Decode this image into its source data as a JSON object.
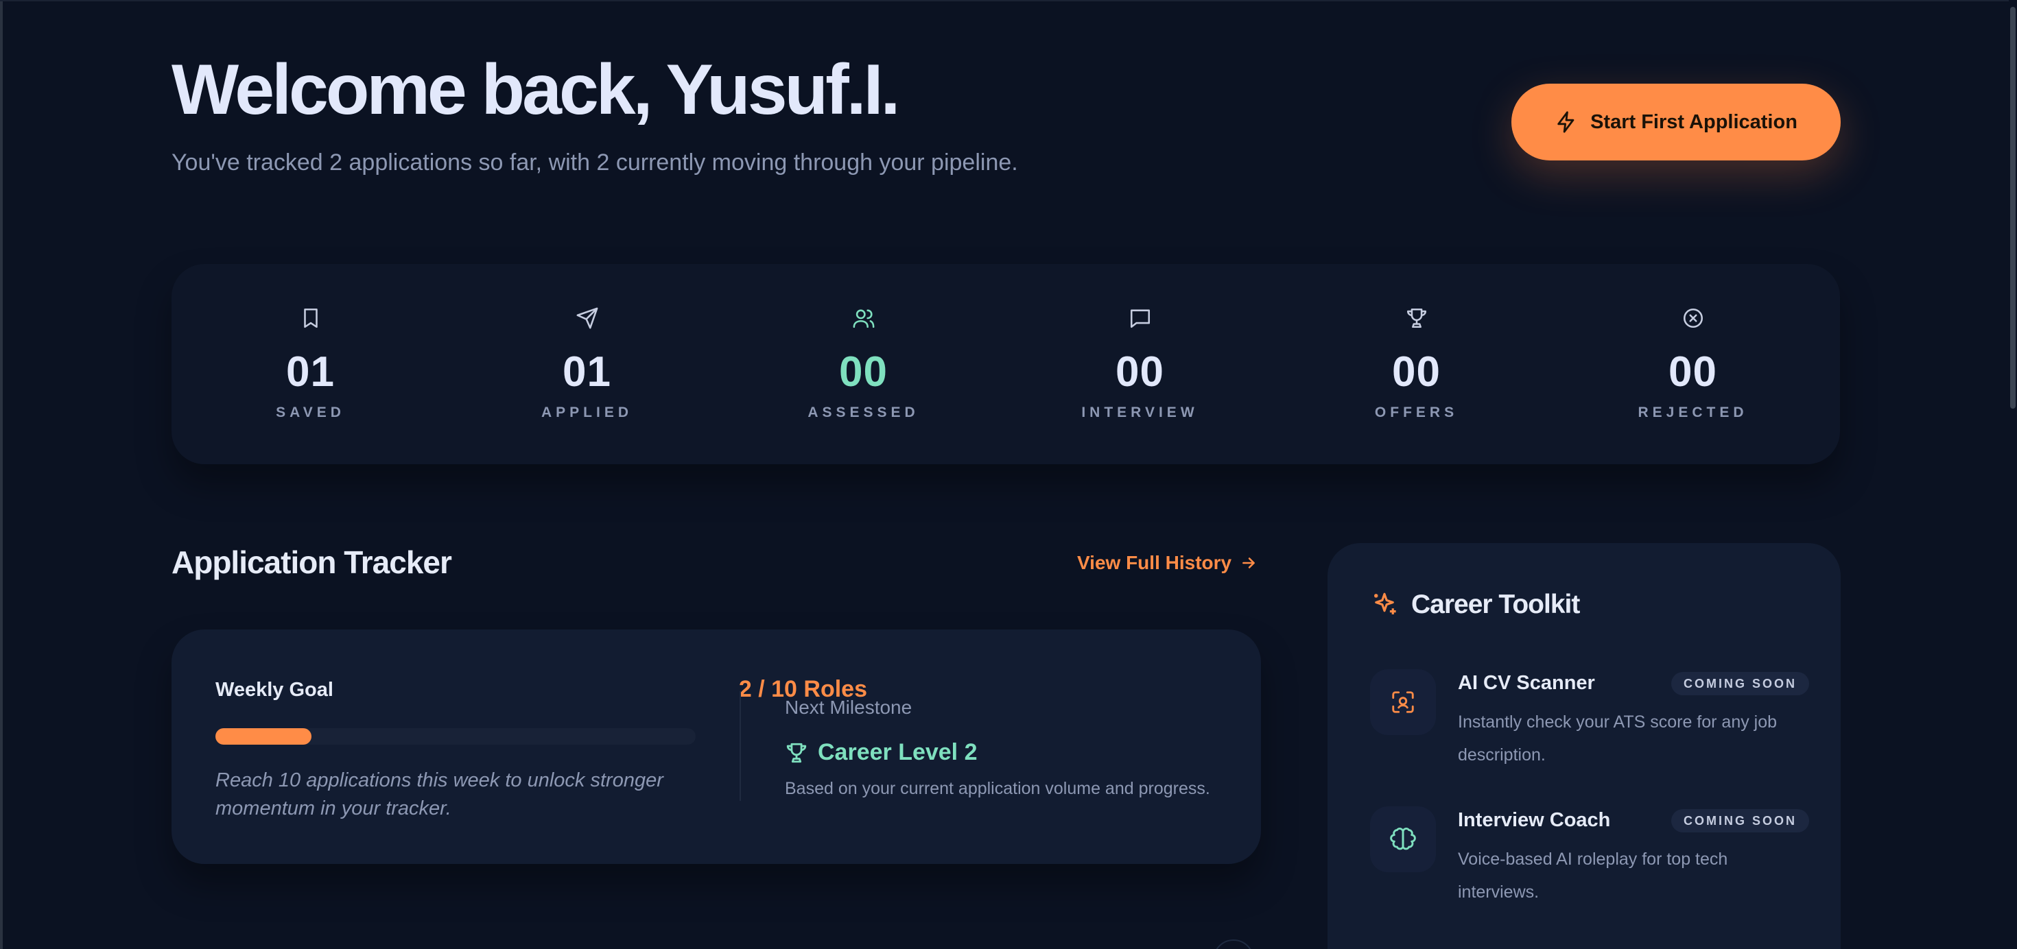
{
  "header": {
    "title": "Welcome back, Yusuf.I.",
    "subtitle": "You've tracked 2 applications so far, with 2 currently moving through your pipeline.",
    "cta_label": "Start First Application",
    "cta_icon": "lightning-icon"
  },
  "stats": [
    {
      "value": "01",
      "label": "SAVED",
      "icon": "bookmark-icon"
    },
    {
      "value": "01",
      "label": "APPLIED",
      "icon": "send-icon"
    },
    {
      "value": "00",
      "label": "ASSESSED",
      "icon": "users-icon"
    },
    {
      "value": "00",
      "label": "INTERVIEW",
      "icon": "message-icon"
    },
    {
      "value": "00",
      "label": "OFFERS",
      "icon": "trophy-icon"
    },
    {
      "value": "00",
      "label": "REJECTED",
      "icon": "x-circle-icon"
    }
  ],
  "tracker": {
    "title": "Application Tracker",
    "history_link": "View Full History",
    "weekly_goal_label": "Weekly Goal",
    "weekly_goal_count": "2 / 10 Roles",
    "weekly_goal_progress": 0.2,
    "weekly_goal_note": "Reach 10 applications this week to unlock stronger momentum in your tracker.",
    "milestone_label": "Next Milestone",
    "milestone_name": "Career Level 2",
    "milestone_desc": "Based on your current application volume and progress."
  },
  "toolkit": {
    "title": "Career Toolkit",
    "tools": [
      {
        "name": "AI CV Scanner",
        "badge": "COMING SOON",
        "desc": "Instantly check your ATS score for any job description.",
        "icon": "scan-icon"
      },
      {
        "name": "Interview Coach",
        "badge": "COMING SOON",
        "desc": "Voice-based AI roleplay for top tech interviews.",
        "icon": "brain-icon"
      }
    ]
  },
  "colors": {
    "background": "#0b1222",
    "accent": "#ff8c47",
    "success": "#7fe0bf",
    "muted": "#8d98b3",
    "card": "#121c31"
  }
}
